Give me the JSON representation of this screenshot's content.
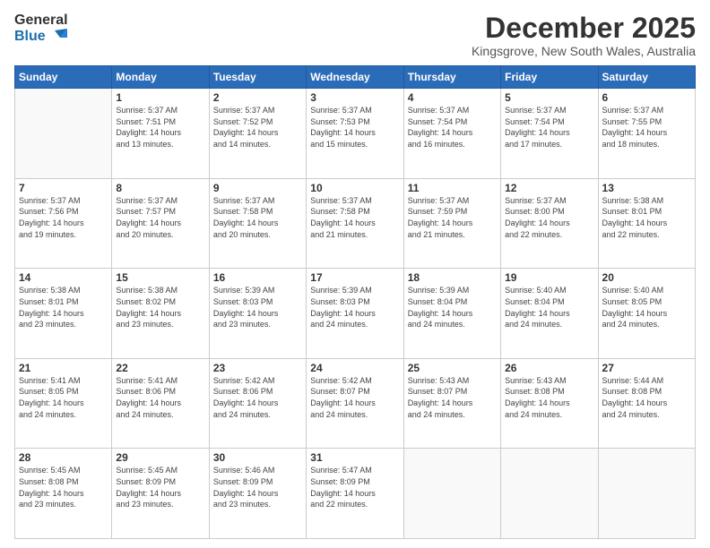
{
  "logo": {
    "line1": "General",
    "line2": "Blue"
  },
  "title": "December 2025",
  "subtitle": "Kingsgrove, New South Wales, Australia",
  "days_header": [
    "Sunday",
    "Monday",
    "Tuesday",
    "Wednesday",
    "Thursday",
    "Friday",
    "Saturday"
  ],
  "weeks": [
    [
      {
        "day": "",
        "info": ""
      },
      {
        "day": "1",
        "info": "Sunrise: 5:37 AM\nSunset: 7:51 PM\nDaylight: 14 hours\nand 13 minutes."
      },
      {
        "day": "2",
        "info": "Sunrise: 5:37 AM\nSunset: 7:52 PM\nDaylight: 14 hours\nand 14 minutes."
      },
      {
        "day": "3",
        "info": "Sunrise: 5:37 AM\nSunset: 7:53 PM\nDaylight: 14 hours\nand 15 minutes."
      },
      {
        "day": "4",
        "info": "Sunrise: 5:37 AM\nSunset: 7:54 PM\nDaylight: 14 hours\nand 16 minutes."
      },
      {
        "day": "5",
        "info": "Sunrise: 5:37 AM\nSunset: 7:54 PM\nDaylight: 14 hours\nand 17 minutes."
      },
      {
        "day": "6",
        "info": "Sunrise: 5:37 AM\nSunset: 7:55 PM\nDaylight: 14 hours\nand 18 minutes."
      }
    ],
    [
      {
        "day": "7",
        "info": "Sunrise: 5:37 AM\nSunset: 7:56 PM\nDaylight: 14 hours\nand 19 minutes."
      },
      {
        "day": "8",
        "info": "Sunrise: 5:37 AM\nSunset: 7:57 PM\nDaylight: 14 hours\nand 20 minutes."
      },
      {
        "day": "9",
        "info": "Sunrise: 5:37 AM\nSunset: 7:58 PM\nDaylight: 14 hours\nand 20 minutes."
      },
      {
        "day": "10",
        "info": "Sunrise: 5:37 AM\nSunset: 7:58 PM\nDaylight: 14 hours\nand 21 minutes."
      },
      {
        "day": "11",
        "info": "Sunrise: 5:37 AM\nSunset: 7:59 PM\nDaylight: 14 hours\nand 21 minutes."
      },
      {
        "day": "12",
        "info": "Sunrise: 5:37 AM\nSunset: 8:00 PM\nDaylight: 14 hours\nand 22 minutes."
      },
      {
        "day": "13",
        "info": "Sunrise: 5:38 AM\nSunset: 8:01 PM\nDaylight: 14 hours\nand 22 minutes."
      }
    ],
    [
      {
        "day": "14",
        "info": "Sunrise: 5:38 AM\nSunset: 8:01 PM\nDaylight: 14 hours\nand 23 minutes."
      },
      {
        "day": "15",
        "info": "Sunrise: 5:38 AM\nSunset: 8:02 PM\nDaylight: 14 hours\nand 23 minutes."
      },
      {
        "day": "16",
        "info": "Sunrise: 5:39 AM\nSunset: 8:03 PM\nDaylight: 14 hours\nand 23 minutes."
      },
      {
        "day": "17",
        "info": "Sunrise: 5:39 AM\nSunset: 8:03 PM\nDaylight: 14 hours\nand 24 minutes."
      },
      {
        "day": "18",
        "info": "Sunrise: 5:39 AM\nSunset: 8:04 PM\nDaylight: 14 hours\nand 24 minutes."
      },
      {
        "day": "19",
        "info": "Sunrise: 5:40 AM\nSunset: 8:04 PM\nDaylight: 14 hours\nand 24 minutes."
      },
      {
        "day": "20",
        "info": "Sunrise: 5:40 AM\nSunset: 8:05 PM\nDaylight: 14 hours\nand 24 minutes."
      }
    ],
    [
      {
        "day": "21",
        "info": "Sunrise: 5:41 AM\nSunset: 8:05 PM\nDaylight: 14 hours\nand 24 minutes."
      },
      {
        "day": "22",
        "info": "Sunrise: 5:41 AM\nSunset: 8:06 PM\nDaylight: 14 hours\nand 24 minutes."
      },
      {
        "day": "23",
        "info": "Sunrise: 5:42 AM\nSunset: 8:06 PM\nDaylight: 14 hours\nand 24 minutes."
      },
      {
        "day": "24",
        "info": "Sunrise: 5:42 AM\nSunset: 8:07 PM\nDaylight: 14 hours\nand 24 minutes."
      },
      {
        "day": "25",
        "info": "Sunrise: 5:43 AM\nSunset: 8:07 PM\nDaylight: 14 hours\nand 24 minutes."
      },
      {
        "day": "26",
        "info": "Sunrise: 5:43 AM\nSunset: 8:08 PM\nDaylight: 14 hours\nand 24 minutes."
      },
      {
        "day": "27",
        "info": "Sunrise: 5:44 AM\nSunset: 8:08 PM\nDaylight: 14 hours\nand 24 minutes."
      }
    ],
    [
      {
        "day": "28",
        "info": "Sunrise: 5:45 AM\nSunset: 8:08 PM\nDaylight: 14 hours\nand 23 minutes."
      },
      {
        "day": "29",
        "info": "Sunrise: 5:45 AM\nSunset: 8:09 PM\nDaylight: 14 hours\nand 23 minutes."
      },
      {
        "day": "30",
        "info": "Sunrise: 5:46 AM\nSunset: 8:09 PM\nDaylight: 14 hours\nand 23 minutes."
      },
      {
        "day": "31",
        "info": "Sunrise: 5:47 AM\nSunset: 8:09 PM\nDaylight: 14 hours\nand 22 minutes."
      },
      {
        "day": "",
        "info": ""
      },
      {
        "day": "",
        "info": ""
      },
      {
        "day": "",
        "info": ""
      }
    ]
  ]
}
